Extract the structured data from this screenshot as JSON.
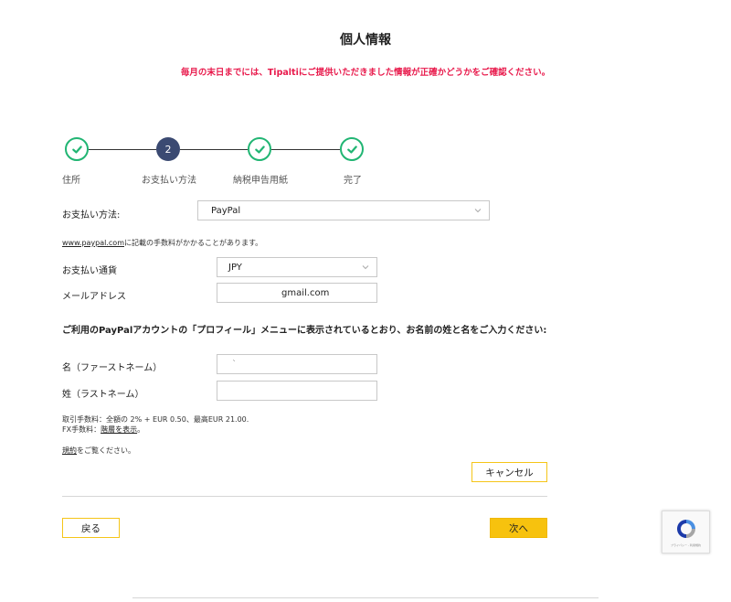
{
  "header": {
    "title": "個人情報",
    "notice": "毎月の末日までには、Tipaltiにご提供いただきました情報が正確かどうかをご確認ください。"
  },
  "stepper": {
    "steps": [
      {
        "label": "住所",
        "state": "done"
      },
      {
        "label": "お支払い方法",
        "state": "active",
        "number": "2"
      },
      {
        "label": "納税申告用紙",
        "state": "done"
      },
      {
        "label": "完了",
        "state": "done"
      }
    ]
  },
  "form": {
    "payment_method_label": "お支払い方法:",
    "payment_method_value": "PayPal",
    "fee_link": "www.paypal.com",
    "fee_note": "に記載の手数料がかかることがあります。",
    "currency_label": "お支払い通貨",
    "currency_value": "JPY",
    "email_label": "メールアドレス",
    "email_value": "gmail.com",
    "name_instruction": "ご利用のPayPalアカウントの「プロフィール」メニューに表示されているとおり、お名前の姓と名をご入力ください:",
    "first_name_label": "名（ファーストネーム）",
    "first_name_value": "`",
    "last_name_label": "姓（ラストネーム）",
    "last_name_value": "",
    "fee_line1": "取引手数料：全額の 2% + EUR 0.50、最高EUR 21.00.",
    "fx_prefix": "FX手数料：",
    "fx_link": "階層を表示",
    "fx_suffix": "。",
    "terms_link": "規約",
    "terms_suffix": "をご覧ください。"
  },
  "buttons": {
    "cancel": "キャンセル",
    "back": "戻る",
    "next": "次へ"
  },
  "recaptcha": {
    "text": "プライバシー - 利用規約"
  },
  "colors": {
    "accent_yellow": "#f7c20e",
    "check_green": "#21b573",
    "active_step": "#3b4a72",
    "notice_red": "#e8194b"
  }
}
